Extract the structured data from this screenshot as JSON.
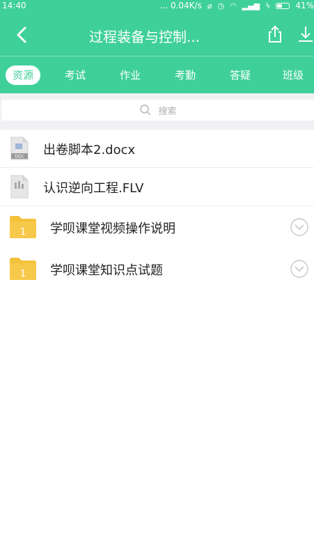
{
  "status_bar": {
    "time": "14:40",
    "network_speed": "... 0.04K/s",
    "battery_percent": "41%",
    "battery_level": 0.41
  },
  "header": {
    "title": "过程装备与控制..."
  },
  "tabs": [
    {
      "label": "资源",
      "active": true
    },
    {
      "label": "考试",
      "active": false
    },
    {
      "label": "作业",
      "active": false
    },
    {
      "label": "考勤",
      "active": false
    },
    {
      "label": "答疑",
      "active": false
    },
    {
      "label": "班级",
      "active": false
    }
  ],
  "search": {
    "placeholder": "搜索"
  },
  "files": [
    {
      "name": "出卷脚本2.docx",
      "icon": "doc-file-icon"
    },
    {
      "name": "认识逆向工程.FLV",
      "icon": "video-file-icon"
    }
  ],
  "folders": [
    {
      "name": "学呗课堂视频操作说明",
      "badge": "1"
    },
    {
      "name": "学呗课堂知识点试题",
      "badge": "1"
    }
  ],
  "colors": {
    "accent": "#3fd09a",
    "folder": "#f4c13a",
    "background": "#f1f1f4"
  }
}
